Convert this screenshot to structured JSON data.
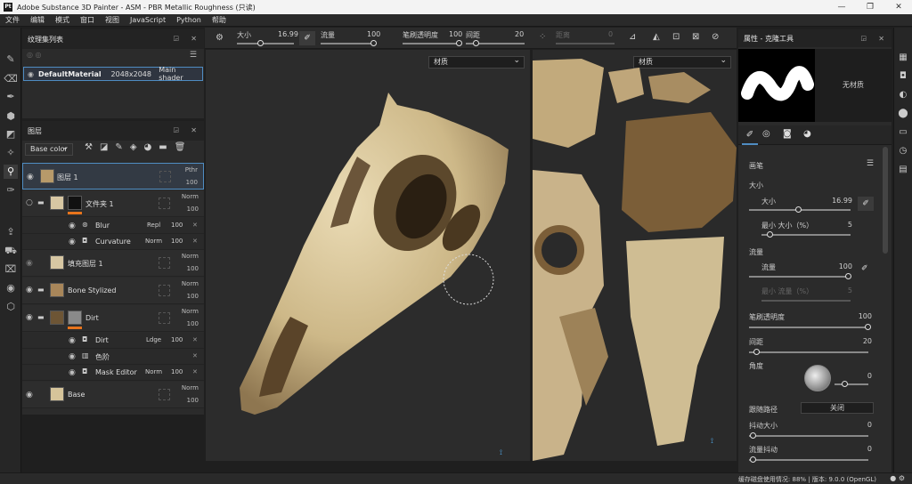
{
  "titlebar": {
    "title": "Adobe Substance 3D Painter - ASM - PBR Metallic Roughness (只读)",
    "logo": "Pt"
  },
  "menu": [
    "文件",
    "编辑",
    "模式",
    "窗口",
    "视图",
    "JavaScript",
    "Python",
    "帮助"
  ],
  "texture_sets": {
    "title": "纹理集列表",
    "item": {
      "name": "DefaultMaterial",
      "size": "2048x2048",
      "shader": "Main shader"
    }
  },
  "layers": {
    "title": "图层",
    "channel": "Base color",
    "items": [
      {
        "name": "图层 1",
        "blend": "Pthr",
        "opacity": "100"
      },
      {
        "name": "文件夹 1",
        "blend": "Norm",
        "opacity": "100"
      },
      {
        "name": "Blur",
        "blend": "Repl",
        "opacity": "100"
      },
      {
        "name": "Curvature",
        "blend": "Norm",
        "opacity": "100"
      },
      {
        "name": "填充图层 1",
        "blend": "Norm",
        "opacity": "100"
      },
      {
        "name": "Bone Stylized",
        "blend": "Norm",
        "opacity": "100"
      },
      {
        "name": "Dirt",
        "blend": "Norm",
        "opacity": "100"
      },
      {
        "name": "Dirt",
        "blend": "Ldge",
        "opacity": "100"
      },
      {
        "name": "色阶",
        "blend": "",
        "opacity": ""
      },
      {
        "name": "Mask Editor",
        "blend": "Norm",
        "opacity": "100"
      },
      {
        "name": "Base",
        "blend": "Norm",
        "opacity": "100"
      }
    ]
  },
  "toolbar": {
    "size_label": "大小",
    "size_value": "16.99",
    "flow_label": "流量",
    "flow_value": "100",
    "opacity_label": "笔刷透明度",
    "opacity_value": "100",
    "spacing_label": "间距",
    "spacing_value": "20",
    "lazy_label": "距离",
    "lazy_value": "0"
  },
  "viewport": {
    "material_dd_3d": "材质",
    "material_dd_2d": "材质"
  },
  "properties": {
    "title": "属性 - 克隆工具",
    "no_material": "无材质",
    "brush_section": "画笔",
    "size_section": "大小",
    "size_label": "大小",
    "size_value": "16.99",
    "min_size_label": "最小 大小（%）",
    "min_size_value": "5",
    "flow_section": "流量",
    "flow_label": "流量",
    "flow_value": "100",
    "min_flow_label": "最小 流量（%）",
    "min_flow_value": "5",
    "brush_opacity_label": "笔刷透明度",
    "brush_opacity_value": "100",
    "spacing_label": "间距",
    "spacing_value": "20",
    "angle_label": "角度",
    "angle_value": "0",
    "follow_path_label": "跟随路径",
    "follow_path_value": "关闭",
    "jitter_size_label": "抖动大小",
    "jitter_size_value": "0",
    "jitter_flow_label": "流量抖动",
    "jitter_flow_value": "0"
  },
  "status": {
    "text": "缓存磁盘使用情况: 88% | 版本: 9.0.0 (OpenGL)"
  },
  "colors": {
    "accent": "#4f8cc2",
    "bone": "#d6c49a",
    "orange": "#e8741c"
  }
}
